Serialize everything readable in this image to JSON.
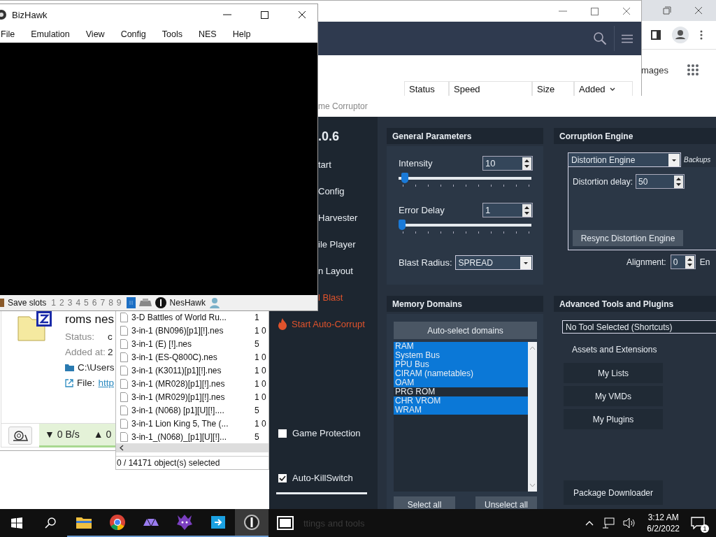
{
  "browser": {
    "link": "mages"
  },
  "torrent": {
    "columns": [
      {
        "label": "Status",
        "sorted": false
      },
      {
        "label": "Speed",
        "sorted": false
      },
      {
        "label": "Size",
        "sorted": false
      },
      {
        "label": "Added",
        "sorted": true
      }
    ],
    "name": "roms nes",
    "fields": [
      {
        "label": "Status:",
        "value": "c"
      },
      {
        "label": "Added at:",
        "value": "2"
      }
    ],
    "path": "C:\\Users",
    "file_label": "File:",
    "file_link": "http",
    "download": "▼ 0 B/s",
    "upload": "▲ 0"
  },
  "file_list": {
    "files": [
      {
        "name": "3-D Battles of World Ru...",
        "size": "1"
      },
      {
        "name": "3-in-1 (BN096)[p1][!].nes",
        "size": "1 0"
      },
      {
        "name": "3-in-1 (E) [!].nes",
        "size": "5"
      },
      {
        "name": "3-in-1 (ES-Q800C).nes",
        "size": "1 0"
      },
      {
        "name": "3-in-1 (K3011)[p1][!].nes",
        "size": "1 0"
      },
      {
        "name": "3-in-1 (MR028)[p1][!].nes",
        "size": "1 0"
      },
      {
        "name": "3-in-1 (MR029)[p1][!].nes",
        "size": "1 0"
      },
      {
        "name": "3-in-1 (N068) [p1][U][!]....",
        "size": "5"
      },
      {
        "name": "3-in-1 Lion King 5, The (...",
        "size": "1 0"
      },
      {
        "name": "3-in-1_(N068)_[p1][U][!]...",
        "size": "5"
      }
    ],
    "status": "0 / 14171 object(s) selected"
  },
  "corruptor": {
    "title": "me Corruptor",
    "version": ".0.6",
    "nav": [
      {
        "label": "tart",
        "kind": "nav"
      },
      {
        "label": "Config",
        "kind": "nav"
      },
      {
        "label": "Harvester",
        "kind": "nav"
      },
      {
        "label": "ile Player",
        "kind": "nav"
      },
      {
        "label": "n Layout",
        "kind": "nav"
      },
      {
        "label": "l Blast",
        "kind": "blast"
      },
      {
        "label": "Start Auto-Corrupt",
        "kind": "auto"
      }
    ],
    "options": [
      {
        "label": "Game Protection",
        "checked": false
      },
      {
        "label": "Auto-KillSwitch",
        "checked": true
      }
    ],
    "general": {
      "title": "General Parameters",
      "sliders": [
        {
          "label": "Intensity",
          "value": "10",
          "level": 0.02
        },
        {
          "label": "Error Delay",
          "value": "1",
          "level": 0
        }
      ],
      "blast_label": "Blast Radius:",
      "blast_value": "SPREAD"
    },
    "engine": {
      "title": "Corruption Engine",
      "engine": "Distortion Engine",
      "backups": "Backups",
      "delay_label": "Distortion delay:",
      "delay_value": "50",
      "resync": "Resync Distortion Engine",
      "alignment_label": "Alignment:",
      "alignment_value": "0",
      "extra": "En"
    },
    "domains": {
      "title": "Memory Domains",
      "auto": "Auto-select domains",
      "items": [
        {
          "label": "RAM",
          "selected": true
        },
        {
          "label": "System Bus",
          "selected": true
        },
        {
          "label": "PPU Bus",
          "selected": true
        },
        {
          "label": "CIRAM (nametables)",
          "selected": true
        },
        {
          "label": "OAM",
          "selected": true
        },
        {
          "label": "PRG ROM",
          "selected": false
        },
        {
          "label": "CHR VROM",
          "selected": true
        },
        {
          "label": "WRAM",
          "selected": true
        }
      ],
      "select_all": "Select all",
      "unselect_all": "Unselect all"
    },
    "advanced": {
      "title": "Advanced Tools and Plugins",
      "tool": "No Tool Selected (Shortcuts)",
      "section": "Assets and Extensions",
      "buttons": [
        "My Lists",
        "My VMDs",
        "My Plugins"
      ],
      "downloader": "Package Downloader"
    },
    "settings": "ttings and tools"
  },
  "bizhawk": {
    "title": "BizHawk",
    "menu": [
      "File",
      "Emulation",
      "View",
      "Config",
      "Tools",
      "NES",
      "Help"
    ],
    "save_label": "Save slots",
    "slots": [
      "1",
      "2",
      "3",
      "4",
      "5",
      "6",
      "7",
      "8",
      "9"
    ],
    "core": "NesHawk"
  },
  "taskbar": {
    "time": "3:12 AM",
    "date": "6/2/2022",
    "notifications": "1"
  }
}
